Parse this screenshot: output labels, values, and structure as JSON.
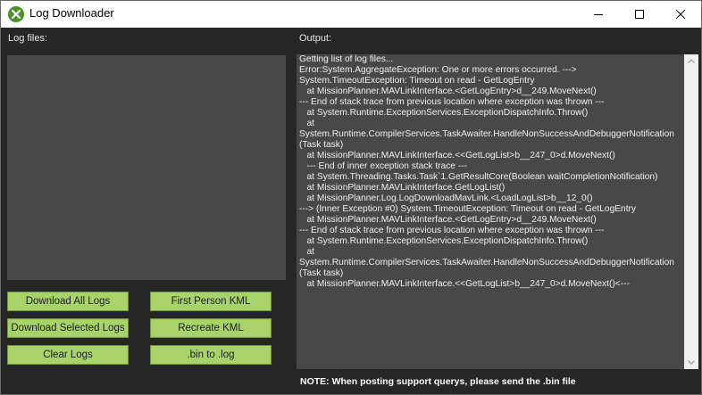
{
  "window": {
    "title": "Log Downloader"
  },
  "labels": {
    "log_files": "Log files:",
    "output": "Output:"
  },
  "buttons": {
    "download_all": "Download All Logs",
    "first_person_kml": "First Person KML",
    "download_selected": "Download Selected Logs",
    "recreate_kml": "Recreate KML",
    "clear_logs": "Clear Logs",
    "bin_to_log": ".bin to .log"
  },
  "output_text": "Getting list of log files...\nError:System.AggregateException: One or more errors occurred. --->\nSystem.TimeoutException: Timeout on read - GetLogEntry\n   at MissionPlanner.MAVLinkInterface.<GetLogEntry>d__249.MoveNext()\n--- End of stack trace from previous location where exception was thrown ---\n   at System.Runtime.ExceptionServices.ExceptionDispatchInfo.Throw()\n   at\nSystem.Runtime.CompilerServices.TaskAwaiter.HandleNonSuccessAndDebuggerNotification(Task task)\n   at MissionPlanner.MAVLinkInterface.<<GetLogList>b__247_0>d.MoveNext()\n   --- End of inner exception stack trace ---\n   at System.Threading.Tasks.Task`1.GetResultCore(Boolean waitCompletionNotification)\n   at MissionPlanner.MAVLinkInterface.GetLogList()\n   at MissionPlanner.Log.LogDownloadMavLink.<LoadLogList>b__12_0()\n---> (Inner Exception #0) System.TimeoutException: Timeout on read - GetLogEntry\n   at MissionPlanner.MAVLinkInterface.<GetLogEntry>d__249.MoveNext()\n--- End of stack trace from previous location where exception was thrown ---\n   at System.Runtime.ExceptionServices.ExceptionDispatchInfo.Throw()\n   at\nSystem.Runtime.CompilerServices.TaskAwaiter.HandleNonSuccessAndDebuggerNotification(Task task)\n   at MissionPlanner.MAVLinkInterface.<<GetLogList>b__247_0>d.MoveNext()<---",
  "note": "NOTE: When posting support querys, please send the .bin file",
  "icons": {
    "app": "mission-planner-icon",
    "minimize": "minimize-icon",
    "maximize": "maximize-icon",
    "close": "close-icon",
    "scroll_up": "scroll-up-arrow-icon",
    "scroll_down": "scroll-down-arrow-icon"
  },
  "colors": {
    "button": "#a8d36b",
    "background": "#262626",
    "panel": "#484848"
  }
}
